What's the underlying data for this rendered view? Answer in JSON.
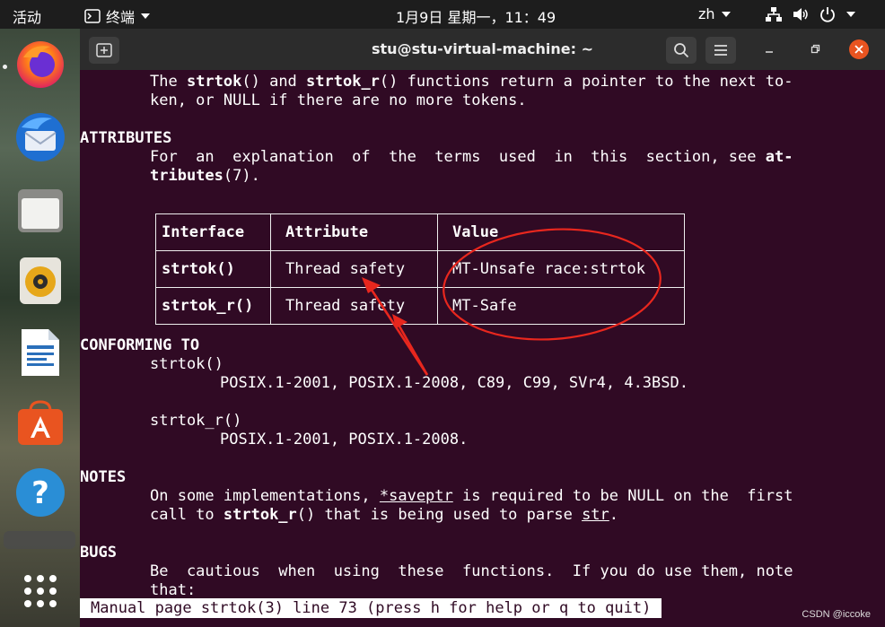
{
  "topbar": {
    "activities": "活动",
    "app_menu": "终端",
    "clock": "1月9日 星期一，11：49",
    "input_method": "zh"
  },
  "window": {
    "title": "stu@stu-virtual-machine: ~"
  },
  "dock": {
    "items": [
      "Firefox",
      "Thunderbird",
      "Files",
      "Rhythmbox",
      "LibreOffice Writer",
      "Ubuntu Software",
      "Help",
      "Show Applications"
    ]
  },
  "manpage": {
    "desc1_a": "The ",
    "desc1_b": "strtok",
    "desc1_c": "() and ",
    "desc1_d": "strtok_r",
    "desc1_e": "() functions return a pointer to the next to‐",
    "desc2": "ken, or NULL if there are no more tokens.",
    "attributes_heading": "ATTRIBUTES",
    "attr_line1_a": "For  an  explanation  of  the  terms  used  in  this  section, see ",
    "attr_line1_b": "at‐",
    "attr_line2_a": "tributes",
    "attr_line2_b": "(7).",
    "table": {
      "headers": [
        "Interface",
        "Attribute",
        "Value"
      ],
      "rows": [
        {
          "interface": "strtok()",
          "attribute": "Thread safety",
          "value": "MT-Unsafe race:strtok"
        },
        {
          "interface": "strtok_r()",
          "attribute": "Thread safety",
          "value": "MT-Safe"
        }
      ]
    },
    "conforming_heading": "CONFORMING TO",
    "conf_fn1": "strtok()",
    "conf_std1": "POSIX.1-2001, POSIX.1-2008, C89, C99, SVr4, 4.3BSD.",
    "conf_fn2": "strtok_r()",
    "conf_std2": "POSIX.1-2001, POSIX.1-2008.",
    "notes_heading": "NOTES",
    "notes1_a": "On some implementations, ",
    "notes1_b": "*saveptr",
    "notes1_c": " is required to be NULL on the  first",
    "notes2_a": "call to ",
    "notes2_b": "strtok_r",
    "notes2_c": "() that is being used to parse ",
    "notes2_d": "str",
    "notes2_e": ".",
    "bugs_heading": "BUGS",
    "bugs1": "Be  cautious  when  using  these  functions.  If you do use them, note",
    "bugs2": "that:",
    "status": "Manual page strtok(3) line 73 (press h for help or q to quit)"
  },
  "watermark": "CSDN @iccoke",
  "colors": {
    "terminal_bg": "#300a24",
    "annotation": "#e8271e",
    "close_button": "#e95420"
  }
}
